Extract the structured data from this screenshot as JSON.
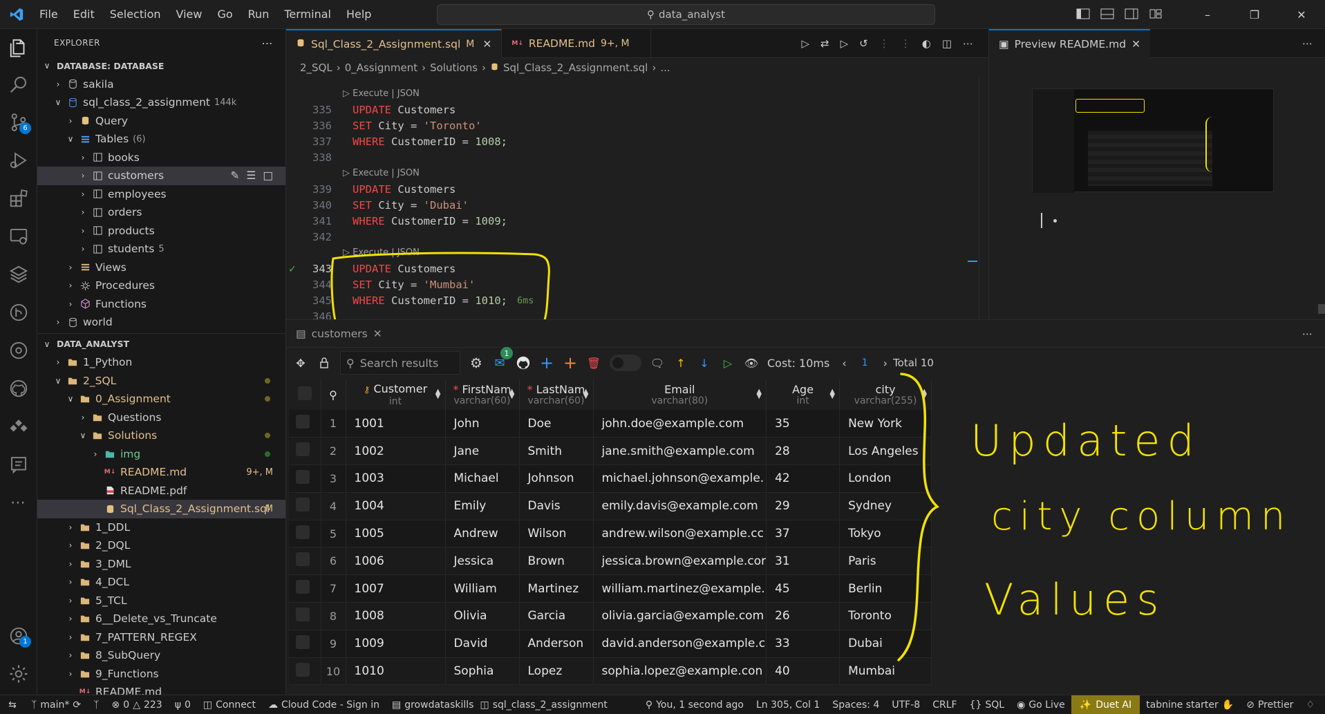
{
  "titlebar": {
    "menu": [
      "File",
      "Edit",
      "Selection",
      "View",
      "Go",
      "Run",
      "Terminal",
      "Help"
    ],
    "search_text": "data_analyst"
  },
  "activity": {
    "source_control_badge": "6",
    "accounts_badge": "1"
  },
  "explorer": {
    "title": "EXPLORER",
    "database_section": "DATABASE: DATABASE",
    "db_items": [
      {
        "label": "sakila"
      },
      {
        "label": "sql_class_2_assignment",
        "extra": "144k"
      },
      {
        "label": "Query"
      },
      {
        "label": "Tables",
        "extra": "(6)"
      },
      {
        "label": "books"
      },
      {
        "label": "customers"
      },
      {
        "label": "employees"
      },
      {
        "label": "orders"
      },
      {
        "label": "products"
      },
      {
        "label": "students",
        "extra": "5"
      },
      {
        "label": "Views"
      },
      {
        "label": "Procedures"
      },
      {
        "label": "Functions"
      },
      {
        "label": "world"
      }
    ],
    "folder_section": "DATA_ANALYST",
    "files": [
      {
        "label": "1_Python"
      },
      {
        "label": "2_SQL"
      },
      {
        "label": "0_Assignment"
      },
      {
        "label": "Questions"
      },
      {
        "label": "Solutions"
      },
      {
        "label": "img"
      },
      {
        "label": "README.md",
        "status": "9+, M"
      },
      {
        "label": "README.pdf"
      },
      {
        "label": "Sql_Class_2_Assignment.sql",
        "status": "M"
      },
      {
        "label": "1_DDL"
      },
      {
        "label": "2_DQL"
      },
      {
        "label": "3_DML"
      },
      {
        "label": "4_DCL"
      },
      {
        "label": "5_TCL"
      },
      {
        "label": "6__Delete_vs_Truncate"
      },
      {
        "label": "7_PATTERN_REGEX"
      },
      {
        "label": "8_SubQuery"
      },
      {
        "label": "9_Functions"
      },
      {
        "label": "README.md"
      }
    ]
  },
  "editor": {
    "tabs": [
      {
        "label": "Sql_Class_2_Assignment.sql",
        "status": "M"
      },
      {
        "label": "README.md",
        "status": "9+, M"
      }
    ],
    "breadcrumb": [
      "2_SQL",
      "0_Assignment",
      "Solutions",
      "Sql_Class_2_Assignment.sql",
      "..."
    ],
    "codelens": "Execute | JSON",
    "lines": [
      {
        "n": "335",
        "kw": "UPDATE",
        "rest": "Customers"
      },
      {
        "n": "336",
        "kw": "SET",
        "col": "City",
        "str": "'Toronto'"
      },
      {
        "n": "337",
        "kw": "WHERE",
        "col": "CustomerID",
        "num": "1008"
      },
      {
        "n": "338"
      },
      {
        "n": "339",
        "kw": "UPDATE",
        "rest": "Customers"
      },
      {
        "n": "340",
        "kw": "SET",
        "col": "City",
        "str": "'Dubai'"
      },
      {
        "n": "341",
        "kw": "WHERE",
        "col": "CustomerID",
        "num": "1009"
      },
      {
        "n": "342"
      },
      {
        "n": "343",
        "kw": "UPDATE",
        "rest": "Customers"
      },
      {
        "n": "344",
        "kw": "SET",
        "col": "City",
        "str": "'Mumbai'"
      },
      {
        "n": "345",
        "kw": "WHERE",
        "col": "CustomerID",
        "num": "1010"
      },
      {
        "n": "346"
      }
    ],
    "timing": "6ms"
  },
  "preview": {
    "tab_label": "Preview README.md"
  },
  "results": {
    "tab_label": "customers",
    "search_placeholder": "Search results",
    "notification_badge": "1",
    "cost": "Cost: 10ms",
    "page": "1",
    "total": "Total 10",
    "columns": [
      {
        "name": "Customer",
        "type": "int"
      },
      {
        "name": "FirstNam",
        "type": "varchar(60)"
      },
      {
        "name": "LastNam",
        "type": "varchar(60)"
      },
      {
        "name": "Email",
        "type": "varchar(80)"
      },
      {
        "name": "Age",
        "type": "int"
      },
      {
        "name": "city",
        "type": "varchar(255)"
      }
    ],
    "rows": [
      [
        "1",
        "1001",
        "John",
        "Doe",
        "john.doe@example.com",
        "35",
        "New York"
      ],
      [
        "2",
        "1002",
        "Jane",
        "Smith",
        "jane.smith@example.com",
        "28",
        "Los Angeles"
      ],
      [
        "3",
        "1003",
        "Michael",
        "Johnson",
        "michael.johnson@example.",
        "42",
        "London"
      ],
      [
        "4",
        "1004",
        "Emily",
        "Davis",
        "emily.davis@example.com",
        "29",
        "Sydney"
      ],
      [
        "5",
        "1005",
        "Andrew",
        "Wilson",
        "andrew.wilson@example.cc",
        "37",
        "Tokyo"
      ],
      [
        "6",
        "1006",
        "Jessica",
        "Brown",
        "jessica.brown@example.cor",
        "31",
        "Paris"
      ],
      [
        "7",
        "1007",
        "William",
        "Martinez",
        "william.martinez@example.",
        "45",
        "Berlin"
      ],
      [
        "8",
        "1008",
        "Olivia",
        "Garcia",
        "olivia.garcia@example.com",
        "26",
        "Toronto"
      ],
      [
        "9",
        "1009",
        "David",
        "Anderson",
        "david.anderson@example.c",
        "33",
        "Dubai"
      ],
      [
        "10",
        "1010",
        "Sophia",
        "Lopez",
        "sophia.lopez@example.con",
        "40",
        "Mumbai"
      ]
    ]
  },
  "annotation": {
    "line1": "Updated",
    "line2": "city column",
    "line3": "Values"
  },
  "statusbar": {
    "branch": "main*",
    "errors": "0",
    "warnings": "223",
    "info": "0",
    "connect": "Connect",
    "cloud_code": "Cloud Code - Sign in",
    "db_server": "growdataskills",
    "db_name": "sql_class_2_assignment",
    "blame": "You, 1 second ago",
    "position": "Ln 305, Col 1",
    "spaces": "Spaces: 4",
    "encoding": "UTF-8",
    "eol": "CRLF",
    "language": "SQL",
    "go_live": "Go Live",
    "duet": "Duet AI",
    "tabnine": "tabnine starter",
    "prettier": "Prettier"
  },
  "colors": {
    "accent": "#0078d4",
    "annotation": "#f2e200",
    "modified": "#e2c08d"
  }
}
